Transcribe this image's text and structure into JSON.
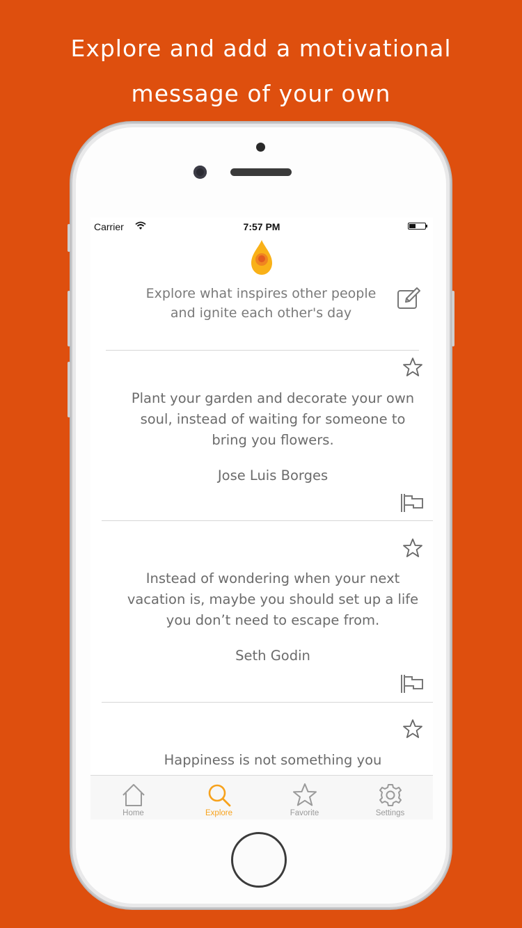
{
  "headline": {
    "line1": "Explore and add a motivational",
    "line2": "message of your own"
  },
  "colors": {
    "background": "#DE4F0E",
    "accent": "#F7A21C",
    "text": "#6b6b6b"
  },
  "status_bar": {
    "carrier": "Carrier",
    "time": "7:57 PM"
  },
  "explore": {
    "intro": "Explore what inspires other people and ignite each other's day"
  },
  "quotes": [
    {
      "text": "Plant your garden and decorate your own soul, instead of waiting for someone to bring you flowers.",
      "author": "Jose Luis Borges"
    },
    {
      "text": "Instead of wondering when your next vacation is, maybe you should set up a life you don’t need to escape from.",
      "author": "Seth Godin"
    },
    {
      "text": "Happiness is not something you",
      "author": ""
    }
  ],
  "tabs": [
    {
      "label": "Home",
      "icon": "home-icon"
    },
    {
      "label": "Explore",
      "icon": "search-icon",
      "active": true
    },
    {
      "label": "Favorite",
      "icon": "star-icon"
    },
    {
      "label": "Settings",
      "icon": "gear-icon"
    }
  ]
}
